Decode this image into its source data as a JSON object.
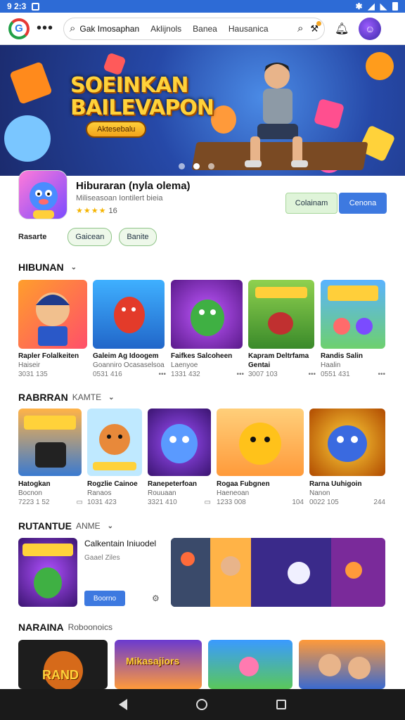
{
  "status": {
    "time": "9 2:3",
    "left_icon": "screen-icon",
    "right_icons": [
      "bluetooth-icon",
      "wifi-icon",
      "signal-icon",
      "battery-icon"
    ]
  },
  "topbar": {
    "search_query": "Gak Imosaphan",
    "tabs": [
      "Aklijnols",
      "Banea",
      "Hausanica"
    ],
    "search_icon": "search-icon"
  },
  "hero": {
    "title_line1": "SOEINKAN",
    "title_line2": "BAILEVAPON",
    "pill_label": "Aktesebalu",
    "slide_count": 3,
    "active_slide": 2
  },
  "app": {
    "name": "Hiburaran (nyla olema)",
    "subtitle": "Miliseasoan Iontilert bieia",
    "rating_stars": "★★★★",
    "rating_value": "16",
    "btn_secondary": "Colainam",
    "btn_primary": "Cenona"
  },
  "chips": {
    "label": "Rasarte",
    "items": [
      "Gaicean",
      "Banite"
    ]
  },
  "sections": {
    "s1": {
      "title": "HIBUNAN",
      "sub": ""
    },
    "s2": {
      "title": "RABRRAN",
      "sub": "KAMTE"
    },
    "s3": {
      "title": "RUTANTUE",
      "sub": "ANME"
    },
    "s4": {
      "title": "NARAINA",
      "sub": "Roboonoics"
    }
  },
  "row1": [
    {
      "title": "Rapler Folalkeiten",
      "sub": "Haiseir",
      "meta": "3031 135",
      "more": "•••"
    },
    {
      "title": "Galeim Ag Idoogem",
      "sub": "Goanniro Ocasaselsoa",
      "meta": "0531 416",
      "more": "•••"
    },
    {
      "title": "Faifkes Salcoheen",
      "sub": "Laenyoe",
      "meta": "1331 432",
      "more": "•••"
    },
    {
      "title": "Kapram Deltrfama Gentai",
      "sub": "",
      "meta": "3007 103",
      "more": "•••"
    },
    {
      "title": "Randis Salin",
      "sub": "Haalin",
      "meta": "0551 431",
      "more": "•••"
    }
  ],
  "row2": [
    {
      "title": "Hatogkan",
      "sub": "Bocnon",
      "meta": "7223 1 52"
    },
    {
      "title": "Rogzlie Cainoe",
      "sub": "Ranaos",
      "meta": "1031 423"
    },
    {
      "title": "Ranepeterfoan",
      "sub": "Rouuaan",
      "meta": "3321 410"
    },
    {
      "title": "Rogaa Fubgnen",
      "sub": "Haeneoan",
      "meta": "1233 008",
      "end": "104"
    },
    {
      "title": "Rarna Uuhigoin",
      "sub": "Nanon",
      "meta": "0022 105",
      "end": "244"
    }
  ],
  "featured": {
    "title": "Calkentain Iniuodel",
    "sub": "Gaael Ziles",
    "button": "Boorno"
  },
  "row4_labels": [
    "RAND",
    "Mikasajiors",
    "",
    ""
  ],
  "nav": [
    "back-icon",
    "home-icon",
    "recents-icon"
  ]
}
